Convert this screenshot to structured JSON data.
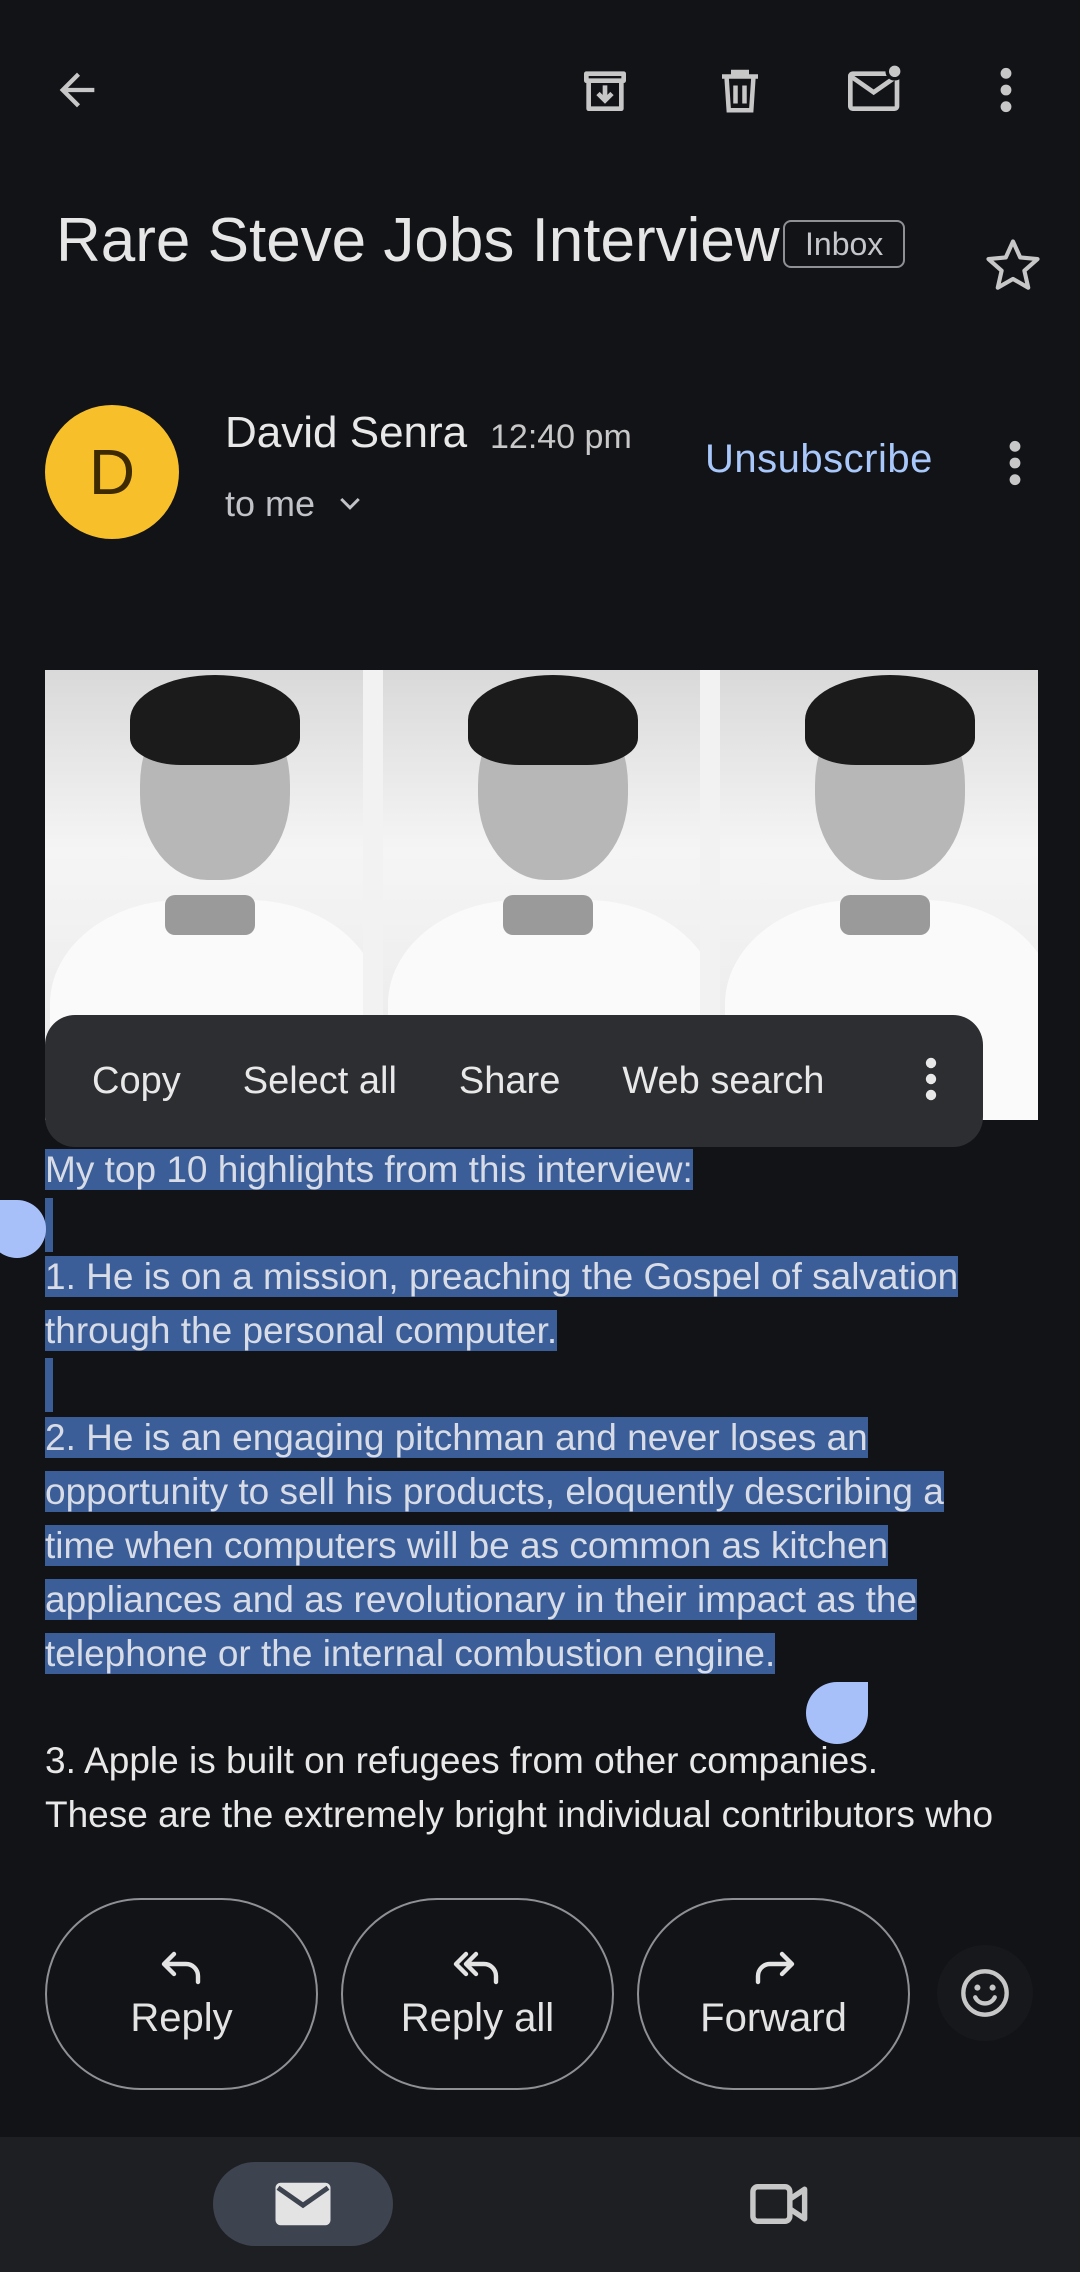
{
  "toolbar": {
    "back": "back-arrow-icon",
    "archive": "archive-icon",
    "delete": "trash-icon",
    "mark_unread": "mark-unread-icon",
    "more": "more-vert-icon"
  },
  "email": {
    "subject": "Rare Steve Jobs Interview",
    "label": "Inbox",
    "sender": {
      "initial": "D",
      "name": "David Senra",
      "time": "12:40 pm",
      "recipient": "to me",
      "avatar_color": "#f7c02a"
    },
    "unsubscribe": "Unsubscribe"
  },
  "context_menu": {
    "copy": "Copy",
    "select_all": "Select all",
    "share": "Share",
    "web_search": "Web search"
  },
  "body": {
    "lines": [
      "My top 10 highlights from this interview:",
      "1.  He is on a mission, preaching the Gospel of salvation",
      "through the personal computer.",
      "2.  He is an engaging pitchman and never loses an",
      "opportunity to sell his products, eloquently describing a",
      "time when computers will be as common as kitchen",
      "appliances and as revolutionary in their impact as the",
      "telephone or the internal combustion engine.",
      "3.  Apple is built on refugees from other companies.",
      "These are the extremely bright individual contributors who"
    ]
  },
  "actions": {
    "reply": "Reply",
    "reply_all": "Reply all",
    "forward": "Forward"
  },
  "colors": {
    "background": "#121317",
    "accent": "#a8c7fa",
    "selection": "#3b5e99"
  }
}
